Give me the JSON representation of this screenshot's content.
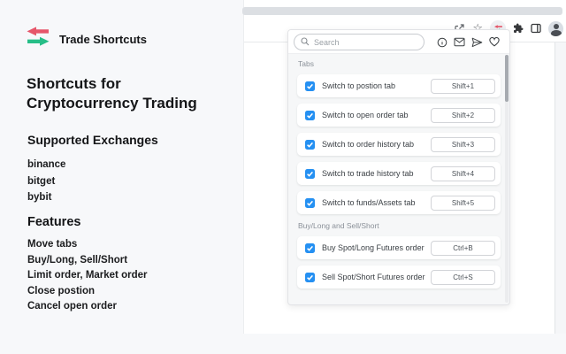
{
  "brand": {
    "name": "Trade Shortcuts"
  },
  "hero": {
    "title_line1": "Shortcuts for",
    "title_line2": "Cryptocurrency Trading"
  },
  "exchanges": {
    "heading": "Supported Exchanges",
    "items": [
      "binance",
      "bitget",
      "bybit"
    ]
  },
  "features": {
    "heading": "Features",
    "items": [
      "Move tabs",
      "Buy/Long, Sell/Short",
      "Limit order, Market order",
      "Close postion",
      "Cancel open order"
    ]
  },
  "browser": {
    "toolbar_icons": [
      "share-icon",
      "bookmark-star-icon",
      "trade-shortcuts-extension-icon",
      "extensions-puzzle-icon",
      "side-panel-icon",
      "profile-avatar"
    ]
  },
  "popup": {
    "search": {
      "placeholder": "Search"
    },
    "header_icons": [
      "info-icon",
      "mail-icon",
      "send-icon",
      "heart-icon"
    ],
    "sections": [
      {
        "label": "Tabs",
        "rows": [
          {
            "label": "Switch to postion tab",
            "shortcut": "Shift+1",
            "checked": true
          },
          {
            "label": "Switch to open order tab",
            "shortcut": "Shift+2",
            "checked": true
          },
          {
            "label": "Switch to order history tab",
            "shortcut": "Shift+3",
            "checked": true
          },
          {
            "label": "Switch to trade history tab",
            "shortcut": "Shift+4",
            "checked": true
          },
          {
            "label": "Switch to funds/Assets tab",
            "shortcut": "Shift+5",
            "checked": true
          }
        ]
      },
      {
        "label": "Buy/Long and Sell/Short",
        "rows": [
          {
            "label": "Buy Spot/Long Futures order",
            "shortcut": "Ctrl+B",
            "checked": true
          },
          {
            "label": "Sell Spot/Short Futures order",
            "shortcut": "Ctrl+S",
            "checked": true
          }
        ]
      }
    ]
  },
  "colors": {
    "background": "#f7f8fa",
    "brand_red": "#e6566a",
    "brand_green": "#27be87",
    "checkbox_blue": "#2590f2",
    "tabstrip_gray": "#dcdfe3",
    "popup_body": "#f6f7f8"
  }
}
